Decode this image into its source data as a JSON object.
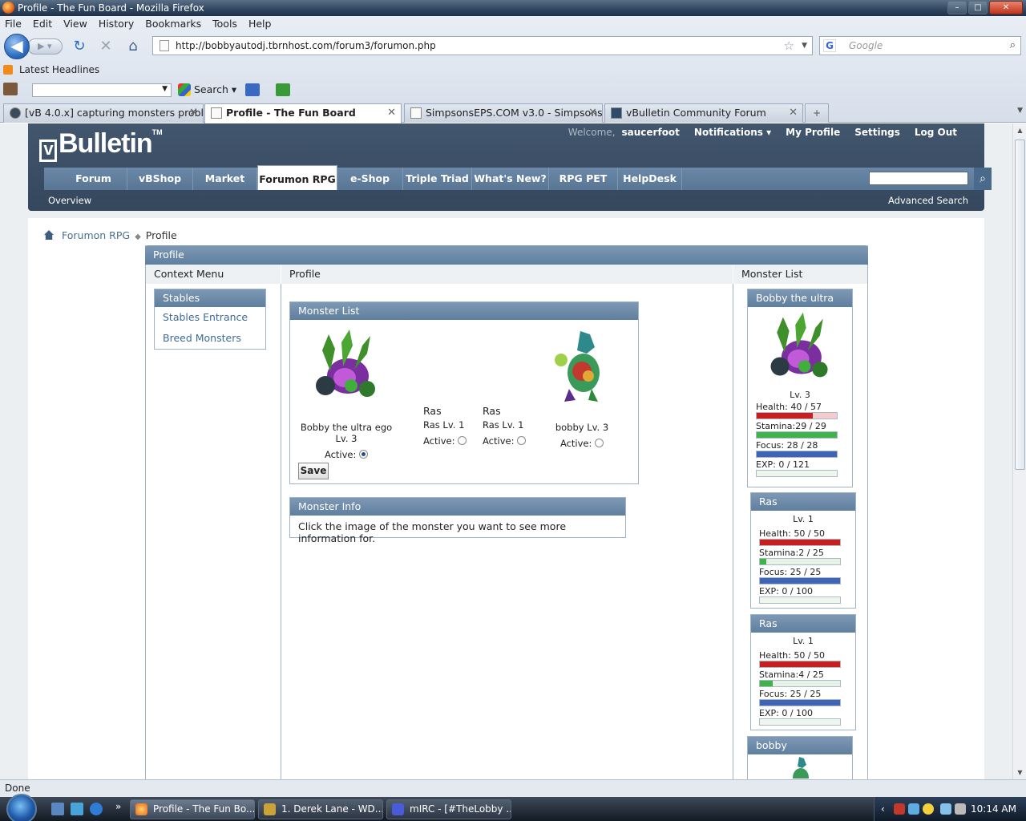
{
  "window": {
    "title": "Profile - The Fun Board - Mozilla Firefox"
  },
  "menu": [
    "File",
    "Edit",
    "View",
    "History",
    "Bookmarks",
    "Tools",
    "Help"
  ],
  "url": "http://bobbyautodj.tbrnhost.com/forum3/forumon.php",
  "search_placeholder": "Google",
  "bookmarks": {
    "headlines": "Latest Headlines",
    "search": "Search"
  },
  "tabs": [
    {
      "label": "[vB 4.0.x] capturing monsters probl...",
      "active": false
    },
    {
      "label": "Profile - The Fun Board",
      "active": true
    },
    {
      "label": "SimpsonsEPS.COM v3.0 - Simpsons...",
      "active": false
    },
    {
      "label": "vBulletin Community Forum",
      "active": false
    }
  ],
  "site": {
    "logo": "Bulletin",
    "logo_tm": "TM",
    "welcome": "Welcome,",
    "username": "saucerfoot",
    "userlinks": [
      "Notifications ▾",
      "My Profile",
      "Settings",
      "Log Out"
    ],
    "nav": [
      "Forum",
      "vBShop",
      "Market",
      "Forumon RPG",
      "e-Shop",
      "Triple Triad",
      "What's New?",
      "RPG PET",
      "HelpDesk"
    ],
    "active_nav": "Forumon RPG",
    "subnav": "Overview",
    "advanced_search": "Advanced Search"
  },
  "breadcrumb": {
    "parent": "Forumon RPG",
    "current": "Profile"
  },
  "panel": {
    "title": "Profile",
    "col_context": "Context Menu",
    "col_profile": "Profile",
    "col_monsters": "Monster List"
  },
  "context_menu": {
    "title": "Stables",
    "items": [
      "Stables Entrance",
      "Breed Monsters"
    ]
  },
  "monster_list": {
    "title": "Monster List",
    "active_label": "Active:",
    "save": "Save",
    "monsters": [
      {
        "name": "",
        "label": "Bobby the ultra ego Lv. 3",
        "active": true,
        "sprite": "hydra"
      },
      {
        "name": "Ras",
        "label": "Ras Lv. 1",
        "active": false,
        "sprite": ""
      },
      {
        "name": "Ras",
        "label": "Ras Lv. 1",
        "active": false,
        "sprite": ""
      },
      {
        "name": "",
        "label": "bobby Lv. 3",
        "active": false,
        "sprite": "dragon"
      }
    ]
  },
  "monster_info": {
    "title": "Monster Info",
    "text": "Click the image of the monster you want to see more information for."
  },
  "cards": [
    {
      "title": "Bobby the ultra ego",
      "level": "Lv. 3",
      "stats": [
        {
          "label": "Health:  40 / 57",
          "value": 40,
          "max": 57,
          "color": "#c81e1e",
          "track": "#f4cccc"
        },
        {
          "label": "Stamina:29 / 29",
          "value": 29,
          "max": 29,
          "color": "#3fb24a",
          "track": "#e6f2e6"
        },
        {
          "label": "Focus:   28 / 28",
          "value": 28,
          "max": 28,
          "color": "#3f63b5",
          "track": "#e2e8f4"
        },
        {
          "label": "EXP:     0 / 121",
          "value": 0,
          "max": 121,
          "color": "#8ccc7f",
          "track": "#eef6ee"
        }
      ]
    },
    {
      "title": "Ras",
      "level": "Lv. 1",
      "stats": [
        {
          "label": "Health:  50 / 50",
          "value": 50,
          "max": 50,
          "color": "#c81e1e",
          "track": "#f4cccc"
        },
        {
          "label": "Stamina:2 / 25",
          "value": 2,
          "max": 25,
          "color": "#3fb24a",
          "track": "#e6f2e6"
        },
        {
          "label": "Focus:   25 / 25",
          "value": 25,
          "max": 25,
          "color": "#3f63b5",
          "track": "#e2e8f4"
        },
        {
          "label": "EXP:     0 / 100",
          "value": 0,
          "max": 100,
          "color": "#8ccc7f",
          "track": "#eef6ee"
        }
      ]
    },
    {
      "title": "Ras",
      "level": "Lv. 1",
      "stats": [
        {
          "label": "Health:  50 / 50",
          "value": 50,
          "max": 50,
          "color": "#c81e1e",
          "track": "#f4cccc"
        },
        {
          "label": "Stamina:4 / 25",
          "value": 4,
          "max": 25,
          "color": "#3fb24a",
          "track": "#e6f2e6"
        },
        {
          "label": "Focus:   25 / 25",
          "value": 25,
          "max": 25,
          "color": "#3f63b5",
          "track": "#e2e8f4"
        },
        {
          "label": "EXP:     0 / 100",
          "value": 0,
          "max": 100,
          "color": "#8ccc7f",
          "track": "#eef6ee"
        }
      ]
    },
    {
      "title": "bobby",
      "level": "",
      "stats": []
    }
  ],
  "status": "Done",
  "taskbar": {
    "items": [
      {
        "label": "Profile - The Fun Bo...",
        "active": true
      },
      {
        "label": "1. Derek Lane - WD...",
        "active": false
      },
      {
        "label": "mIRC - [#TheLobby ...",
        "active": false
      }
    ],
    "clock": "10:14 AM"
  }
}
